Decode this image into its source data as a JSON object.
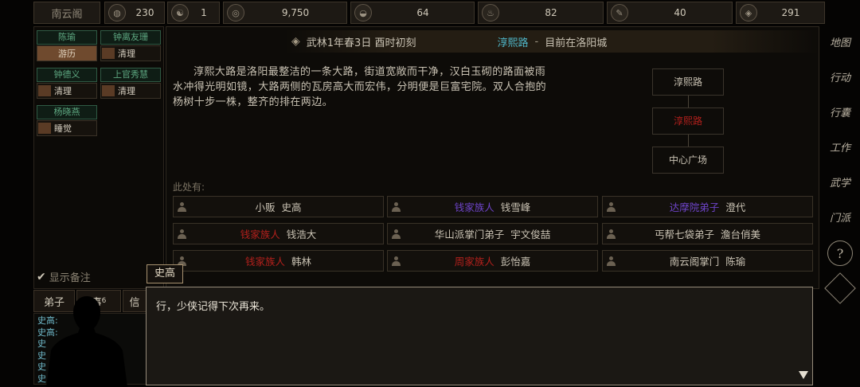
{
  "top": {
    "sect_name": "南云阁",
    "resources": [
      {
        "icon": "globe-icon",
        "value": "230"
      },
      {
        "icon": "yin-yang-icon",
        "value": "1"
      },
      {
        "icon": "coin-icon",
        "value": "9,750"
      },
      {
        "icon": "food-bowl-icon",
        "value": "64"
      },
      {
        "icon": "incense-icon",
        "value": "82"
      },
      {
        "icon": "brush-icon",
        "value": "40"
      },
      {
        "icon": "ore-icon",
        "value": "291"
      }
    ]
  },
  "party": [
    {
      "name": "陈瑜",
      "action": "游历"
    },
    {
      "name": "钟离友珊",
      "action": "清理"
    },
    {
      "name": "钟德义",
      "action": "清理"
    },
    {
      "name": "上官秀慧",
      "action": "清理"
    },
    {
      "name": "杨晓燕",
      "action": "睡觉"
    }
  ],
  "memo_label": "显示备注",
  "tabs": {
    "disciples": "弟子",
    "events": "事",
    "events_badge": "6",
    "letters": "信"
  },
  "chat_log": [
    "史高:",
    "史高:",
    "史",
    "史",
    "史",
    "史",
    "史"
  ],
  "header": {
    "time": "武林1年春3日 酉时初刻",
    "location": "淳熙路",
    "sep": "-",
    "current": "目前在洛阳城"
  },
  "description": "淳熙大路是洛阳最整洁的一条大路，街道宽敞而干净，汉白玉砌的路面被雨水冲得光明如镜，大路两侧的瓦房高大而宏伟，分明便是巨富宅院。双人合抱的杨树十步一株，整齐的排在两边。",
  "minimap": {
    "north": "淳熙路",
    "current": "淳熙路",
    "south": "中心广场"
  },
  "here_label": "此处有:",
  "npcs": [
    {
      "role": "小贩",
      "name": "史高",
      "role_color": "beige"
    },
    {
      "role": "钱家族人",
      "name": "钱雪峰",
      "role_color": "purple"
    },
    {
      "role": "达摩院弟子",
      "name": "澄代",
      "role_color": "purple"
    },
    {
      "role": "钱家族人",
      "name": "钱浩大",
      "role_color": "red"
    },
    {
      "role": "华山派掌门弟子",
      "name": "宇文俊喆",
      "role_color": "beige"
    },
    {
      "role": "丐帮七袋弟子",
      "name": "澹台俏美",
      "role_color": "beige"
    },
    {
      "role": "钱家族人",
      "name": "韩林",
      "role_color": "red"
    },
    {
      "role": "周家族人",
      "name": "彭怡嘉",
      "role_color": "red"
    },
    {
      "role": "南云阁掌门",
      "name": "陈瑜",
      "role_color": "beige"
    }
  ],
  "side_menu": [
    "地图",
    "行动",
    "行囊",
    "工作",
    "武学",
    "门派",
    "?",
    "设置"
  ],
  "dialog": {
    "speaker": "史高",
    "text": "行，少侠记得下次再来。"
  }
}
